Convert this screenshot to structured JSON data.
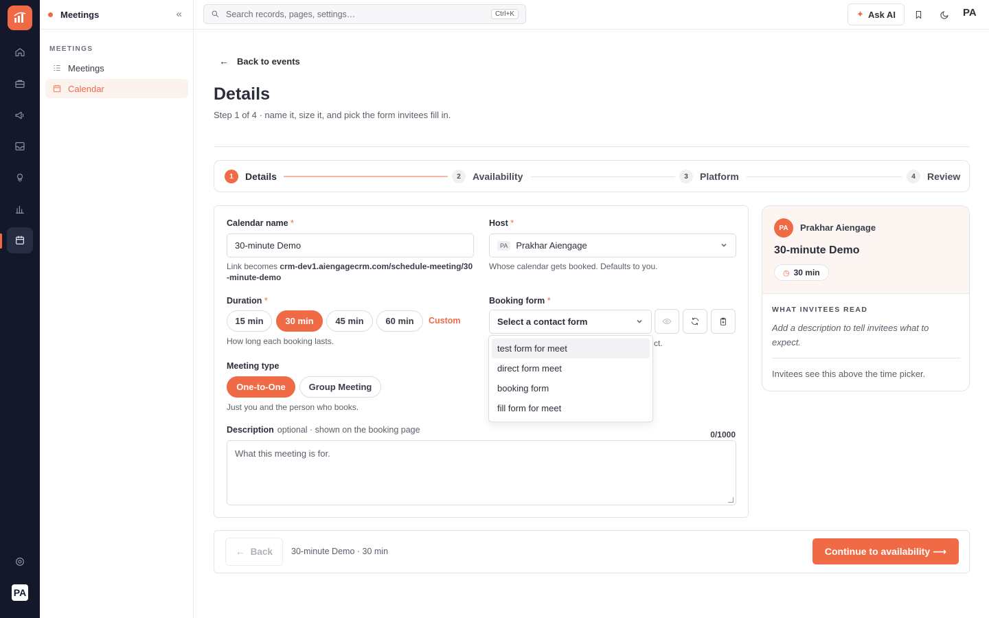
{
  "sidebar": {
    "title": "Meetings",
    "section": "MEETINGS",
    "items": [
      {
        "label": "Meetings"
      },
      {
        "label": "Calendar"
      }
    ]
  },
  "rail": {
    "avatar": "PA",
    "icons": [
      "home-icon",
      "briefcase-icon",
      "megaphone-icon",
      "inbox-icon",
      "rocket-icon",
      "bar-chart-icon",
      "calendar-icon",
      "gear-icon"
    ]
  },
  "topbar": {
    "search_placeholder": "Search records, pages, settings…",
    "shortcut": "Ctrl+K",
    "ask_ai": "Ask AI",
    "avatar": "PA"
  },
  "page": {
    "back_label": "Back to events",
    "title": "Details",
    "subtitle": "Step 1 of 4 · name it, size it, and pick the form invitees fill in."
  },
  "stepper": [
    {
      "num": "1",
      "label": "Details"
    },
    {
      "num": "2",
      "label": "Availability"
    },
    {
      "num": "3",
      "label": "Platform"
    },
    {
      "num": "4",
      "label": "Review"
    }
  ],
  "form": {
    "calendar_name_label": "Calendar name",
    "calendar_name_value": "30-minute Demo",
    "link_prefix": "Link becomes ",
    "link_url": "crm-dev1.aiengagecrm.com/schedule-meeting/30-minute-demo",
    "host_label": "Host",
    "host_initials": "PA",
    "host_value": "Prakhar Aiengage",
    "host_help": "Whose calendar gets booked. Defaults to you.",
    "duration_label": "Duration",
    "durations": [
      "15 min",
      "30 min",
      "45 min",
      "60 min"
    ],
    "custom": "Custom",
    "duration_help": "How long each booking lasts.",
    "booking_form_label": "Booking form",
    "booking_form_placeholder": "Select a contact form",
    "booking_form_help_tail": "ct.",
    "meeting_type_label": "Meeting type",
    "meeting_types": [
      "One-to-One",
      "Group Meeting"
    ],
    "meeting_type_help": "Just you and the person who books.",
    "description_label": "Description",
    "description_optional": "optional · shown on the booking page",
    "description_counter": "0/1000",
    "description_placeholder": "What this meeting is for.",
    "required_mark": "*"
  },
  "dropdown": {
    "options": [
      "test form for meet",
      "direct form meet",
      "booking form",
      "fill form for meet"
    ]
  },
  "preview": {
    "avatar": "PA",
    "host": "Prakhar Aiengage",
    "title": "30-minute Demo",
    "duration": "30 min",
    "section": "WHAT INVITEES READ",
    "description": "Add a description to tell invitees what to expect.",
    "footnote": "Invitees see this above the time picker."
  },
  "footer": {
    "back": "Back",
    "summary": "30-minute Demo · 30 min",
    "continue": "Continue to availability ⟶"
  },
  "colors": {
    "accent": "#ef6a45",
    "rail": "#14182a"
  }
}
